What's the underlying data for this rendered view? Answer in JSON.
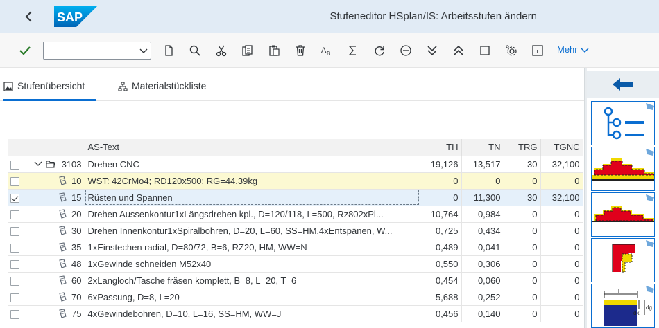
{
  "header": {
    "back_icon": "chevron-left-icon",
    "logo_text": "SAP",
    "title": "Stufeneditor HSplan/IS: Arbeitsstufen ändern"
  },
  "toolbar": {
    "confirm_icon": "checkmark-icon",
    "command_field_value": "",
    "icons": [
      "new-document-icon",
      "find-icon",
      "cut-icon",
      "copy-icon",
      "paste-icon",
      "delete-icon",
      "sort-az-icon",
      "sum-icon",
      "refresh-icon",
      "collapse-minus-icon",
      "expand-all-icon",
      "collapse-all-icon",
      "select-box-icon",
      "settings-icon",
      "info-icon"
    ],
    "more_label": "Mehr"
  },
  "tabs": [
    {
      "label": "Stufenübersicht",
      "icon": "image-icon",
      "active": true
    },
    {
      "label": "Materialstückliste",
      "icon": "hierarchy-icon",
      "active": false
    }
  ],
  "table": {
    "columns": [
      "",
      "",
      "AS-Text",
      "TH",
      "TN",
      "TRG",
      "TGNC"
    ],
    "rows": [
      {
        "checked": false,
        "pos": "3103",
        "text": "Drehen CNC",
        "th": "19,126",
        "tn": "13,517",
        "trg": "30",
        "tgnc": "32,100",
        "type": "root"
      },
      {
        "checked": false,
        "pos": "10",
        "text": "WST: 42CrMo4; RD120x500; RG=44.39kg",
        "th": "0",
        "tn": "0",
        "trg": "0",
        "tgnc": "0",
        "type": "highlight"
      },
      {
        "checked": true,
        "pos": "15",
        "text": "Rüsten und Spannen",
        "th": "0",
        "tn": "11,300",
        "trg": "30",
        "tgnc": "32,100",
        "type": "selected"
      },
      {
        "checked": false,
        "pos": "20",
        "text": "Drehen Aussenkontur1xLängsdrehen kpl., D=120/118, L=500, Rz802xPl...",
        "th": "10,764",
        "tn": "0,984",
        "trg": "0",
        "tgnc": "0",
        "type": "normal"
      },
      {
        "checked": false,
        "pos": "30",
        "text": "Drehen Innenkontur1xSpiralbohren, D=20, L=60, SS=HM,4xEntspänen, W...",
        "th": "0,725",
        "tn": "0,434",
        "trg": "0",
        "tgnc": "0",
        "type": "normal"
      },
      {
        "checked": false,
        "pos": "35",
        "text": "1xEinstechen radial, D=80/72, B=6, RZ20, HM, WW=N",
        "th": "0,489",
        "tn": "0,041",
        "trg": "0",
        "tgnc": "0",
        "type": "normal"
      },
      {
        "checked": false,
        "pos": "48",
        "text": "1xGewinde schneiden M52x40",
        "th": "0,550",
        "tn": "0,306",
        "trg": "0",
        "tgnc": "0",
        "type": "normal"
      },
      {
        "checked": false,
        "pos": "60",
        "text": "2xLangloch/Tasche fräsen komplett, B=8, L=20, T=6",
        "th": "0,454",
        "tn": "0,060",
        "trg": "0",
        "tgnc": "0",
        "type": "normal"
      },
      {
        "checked": false,
        "pos": "70",
        "text": "6xPassung, D=8, L=20",
        "th": "5,688",
        "tn": "0,252",
        "trg": "0",
        "tgnc": "0",
        "type": "normal"
      },
      {
        "checked": false,
        "pos": "75",
        "text": "4xGewindebohren, D=10, L=16, SS=HM, WW=J",
        "th": "0,456",
        "tn": "0,140",
        "trg": "0",
        "tgnc": "0",
        "type": "normal"
      }
    ]
  },
  "right_panel": {
    "arrow_icon": "arrow-left-icon",
    "buttons": [
      "tree-structure-icon",
      "turning-profile-icon",
      "contour-turning-icon",
      "step-profile-icon",
      "groove-dimension-icon"
    ],
    "groove_labels": {
      "l": "l",
      "dk": "dk",
      "dg": "dg"
    }
  },
  "colors": {
    "header_bg": "#e1ebf5",
    "accent": "#0a6ed1",
    "highlight_row": "#fcf9d2",
    "selected_row": "#e5f0fa",
    "profile_red": "#e0001b",
    "profile_yellow": "#f0d800"
  }
}
